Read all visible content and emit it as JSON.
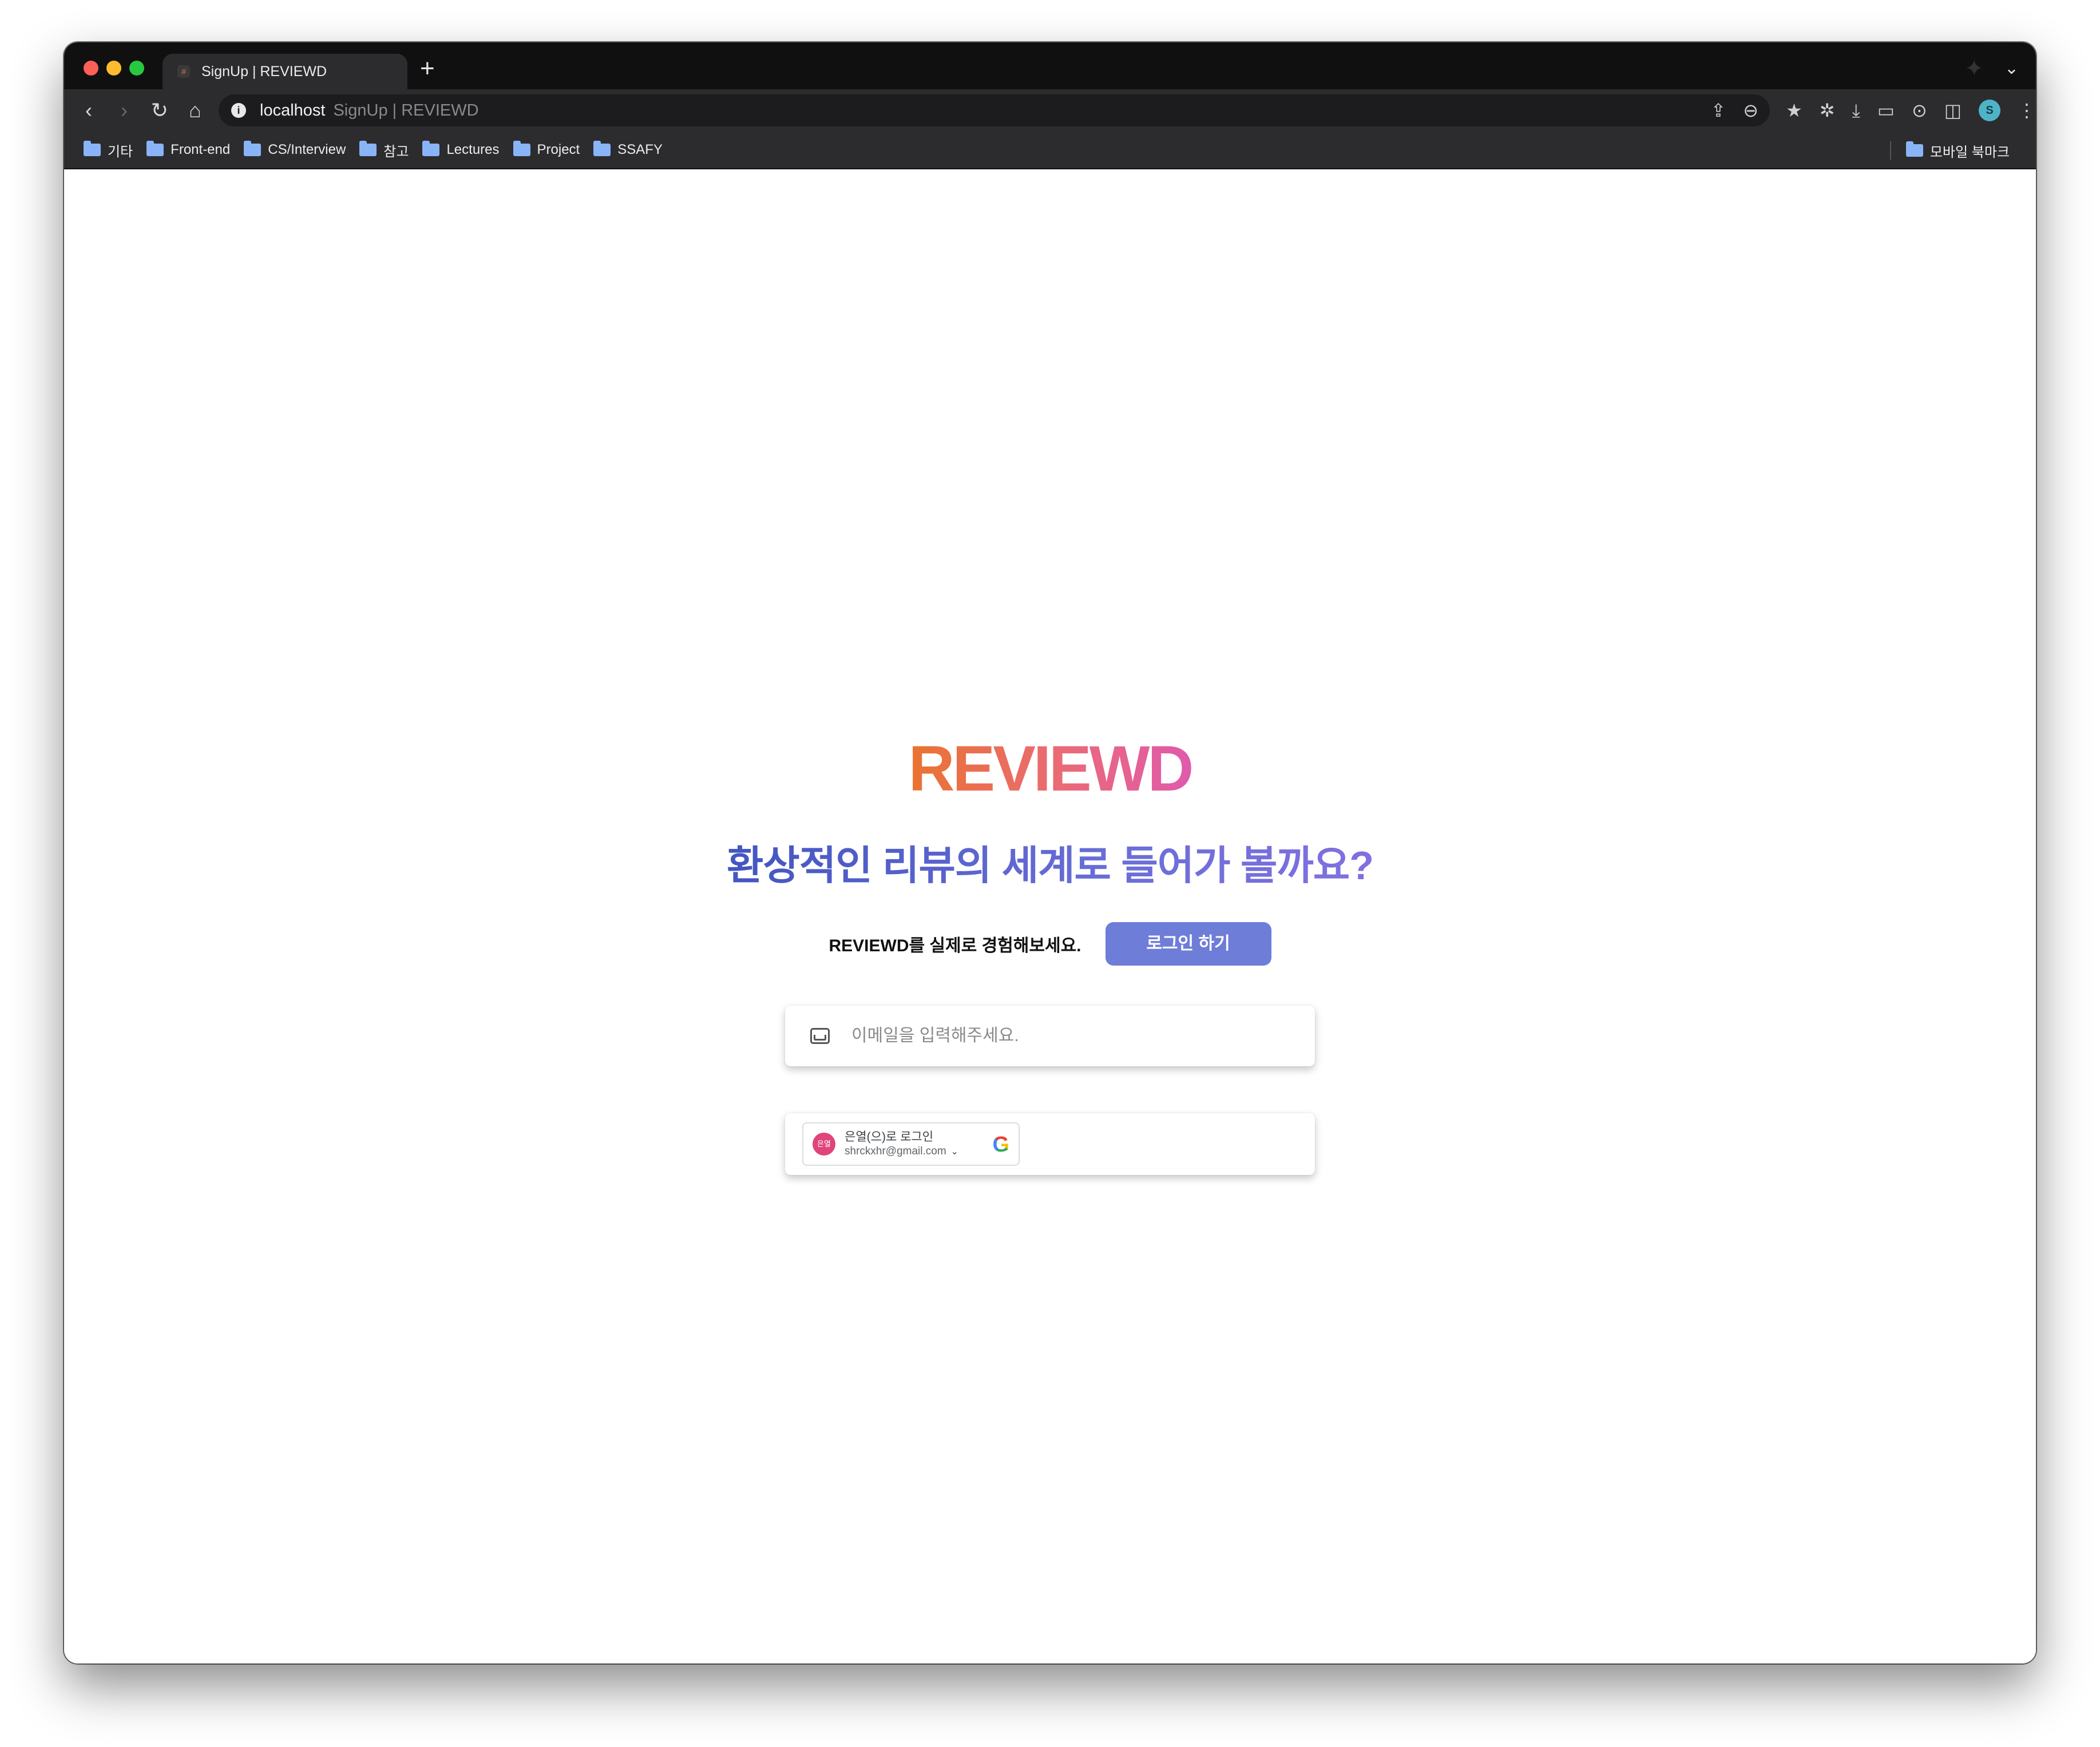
{
  "browser": {
    "tab_title": "SignUp | REVIEWD",
    "tab_favicon": "#",
    "new_tab_label": "+",
    "url_host": "localhost",
    "url_page_title": "SignUp | REVIEWD",
    "profile_initial": "S",
    "icons": {
      "back": "‹",
      "forward": "›",
      "reload": "↻",
      "home": "⌂",
      "info": "i",
      "share": "⇪",
      "zoom": "⊖",
      "star": "★",
      "extensions": "✲",
      "download": "⤓",
      "media": "▭",
      "screenshot": "⊙",
      "sidepanel": "◫",
      "menu": "⋮",
      "chevron": "⌄",
      "bird": "✦"
    }
  },
  "bookmarks": {
    "items": [
      "기타",
      "Front-end",
      "CS/Interview",
      "참고",
      "Lectures",
      "Project",
      "SSAFY"
    ],
    "mobile": "모바일 북마크"
  },
  "page": {
    "logo": "REVIEWD",
    "headline": "환상적인 리뷰의 세계로 들어가 볼까요?",
    "cta_text": "REVIEWD를 실제로 경험해보세요.",
    "login_button": "로그인 하기",
    "email_placeholder": "이메일을 입력해주세요.",
    "email_value": "",
    "google": {
      "avatar_text": "은열",
      "signin_label": "은열(으)로 로그인",
      "email": "shrckxhr@gmail.com",
      "caret": "⌄",
      "logo": "G"
    }
  },
  "colors": {
    "brand_orange": "#ea7330",
    "brand_pink": "#e05aac",
    "headline_blue": "#4355c0",
    "button_blue": "#6e7dd8"
  }
}
